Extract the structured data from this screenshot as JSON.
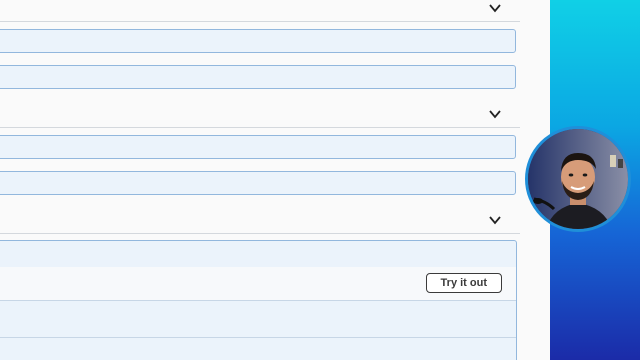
{
  "sections": [
    {
      "chevron_icon": "chevron-down-icon"
    },
    {
      "chevron_icon": "chevron-down-icon"
    },
    {
      "chevron_icon": "chevron-down-icon"
    }
  ],
  "operation": {
    "try_button_label": "Try it out"
  },
  "webcam": {
    "description_icon": "presenter-avatar"
  },
  "colors": {
    "bar_bg": "#ebf3fb",
    "bar_border": "#92b7dd",
    "gradient_top": "#10d0e6",
    "gradient_bottom": "#1b2ba8"
  }
}
